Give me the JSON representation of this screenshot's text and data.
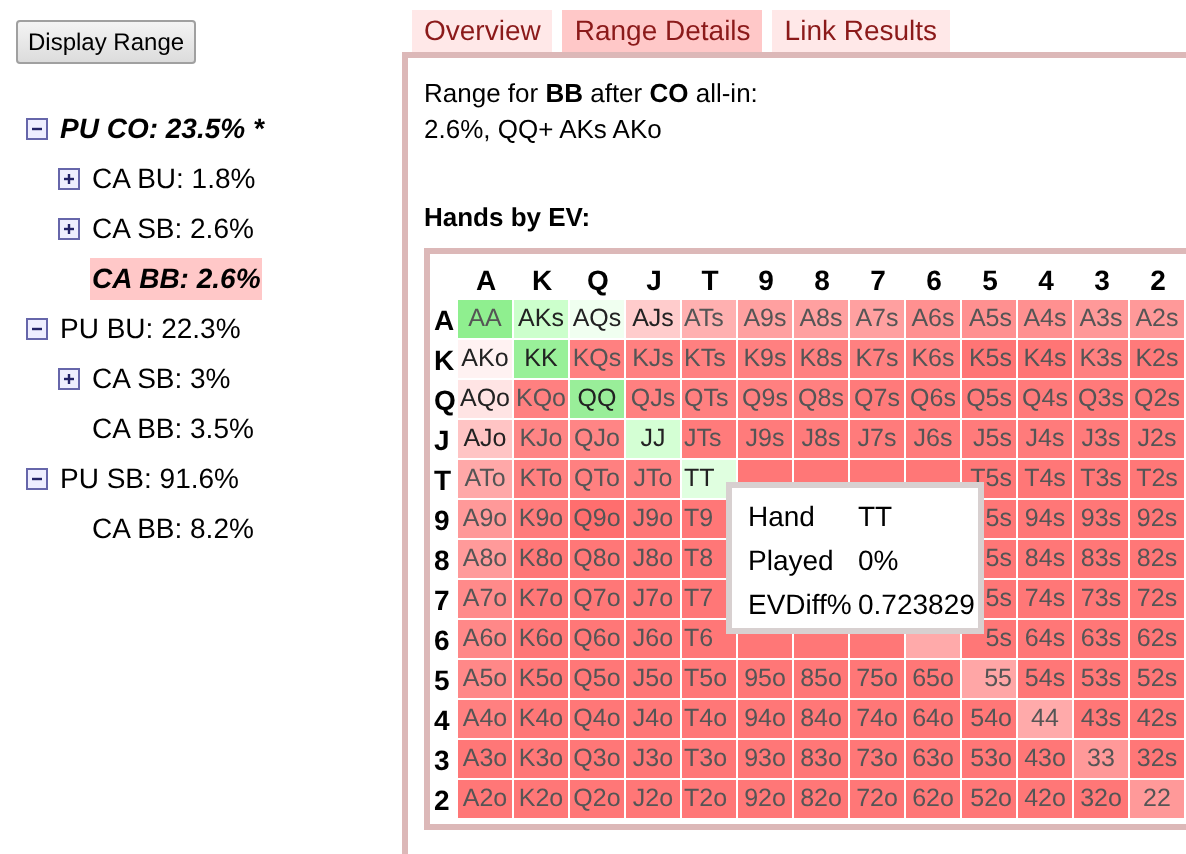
{
  "display_button": "Display Range",
  "tree": [
    {
      "label": "PU CO: 23.5% *",
      "expanded": true,
      "emphasized": true,
      "selected": false,
      "children": [
        {
          "label": "CA BU: 1.8%",
          "expanded": false,
          "emphasized": false,
          "selected": false
        },
        {
          "label": "CA SB: 2.6%",
          "expanded": false,
          "emphasized": false,
          "selected": false
        },
        {
          "label": "CA BB: 2.6%",
          "emphasized": true,
          "selected": true
        }
      ]
    },
    {
      "label": "PU BU: 22.3%",
      "expanded": true,
      "emphasized": false,
      "selected": false,
      "children": [
        {
          "label": "CA SB: 3%",
          "expanded": false,
          "emphasized": false,
          "selected": false
        },
        {
          "label": "CA BB: 3.5%",
          "emphasized": false,
          "selected": false
        }
      ]
    },
    {
      "label": "PU SB: 91.6%",
      "expanded": true,
      "emphasized": false,
      "selected": false,
      "children": [
        {
          "label": "CA BB: 8.2%",
          "emphasized": false,
          "selected": false
        }
      ]
    }
  ],
  "tabs": [
    {
      "label": "Overview",
      "selected": false
    },
    {
      "label": "Range Details",
      "selected": true
    },
    {
      "label": "Link Results",
      "selected": false
    }
  ],
  "description": [
    "Range for **BB** after **CO** all-in:",
    "2.6%, QQ+ AKs AKo"
  ],
  "heading": "Hands by EV:",
  "grid": {
    "columns": [
      "A",
      "K",
      "Q",
      "J",
      "T",
      "9",
      "8",
      "7",
      "6",
      "5",
      "4",
      "3",
      "2"
    ],
    "rows": [
      {
        "label": "A",
        "cells": [
          {
            "text": "AA",
            "color": "#8fef8f"
          },
          {
            "text": "AKs",
            "color": "#ccffcc"
          },
          {
            "text": "AQs",
            "color": "#f0fff0"
          },
          {
            "text": "AJs",
            "color": "#ffcccc"
          },
          {
            "text": "ATs",
            "color": "#ffb0b0"
          },
          {
            "text": "A9s",
            "color": "#ffa0a0"
          },
          {
            "text": "A8s",
            "color": "#ffa0a0"
          },
          {
            "text": "A7s",
            "color": "#ffa0a0"
          },
          {
            "text": "A6s",
            "color": "#ff9090"
          },
          {
            "text": "A5s",
            "color": "#ff9090"
          },
          {
            "text": "A4s",
            "color": "#ff9090"
          },
          {
            "text": "A3s",
            "color": "#ff9999"
          },
          {
            "text": "A2s",
            "color": "#ff9999"
          }
        ]
      },
      {
        "label": "K",
        "cells": [
          {
            "text": "AKo",
            "color": "#fff2f2"
          },
          {
            "text": "KK",
            "color": "#99f099"
          },
          {
            "text": "KQs",
            "color": "#ff8080"
          },
          {
            "text": "KJs",
            "color": "#ff8080"
          },
          {
            "text": "KTs",
            "color": "#ff8080"
          },
          {
            "text": "K9s",
            "color": "#ff8080"
          },
          {
            "text": "K8s",
            "color": "#ff8080"
          },
          {
            "text": "K7s",
            "color": "#ff8080"
          },
          {
            "text": "K6s",
            "color": "#ff8080"
          },
          {
            "text": "K5s",
            "color": "#ff7575"
          },
          {
            "text": "K4s",
            "color": "#ff7575"
          },
          {
            "text": "K3s",
            "color": "#ff8080"
          },
          {
            "text": "K2s",
            "color": "#ff7a7a"
          }
        ]
      },
      {
        "label": "Q",
        "cells": [
          {
            "text": "AQo",
            "color": "#ffe4e4"
          },
          {
            "text": "KQo",
            "color": "#ff8080"
          },
          {
            "text": "QQ",
            "color": "#99ee99"
          },
          {
            "text": "QJs",
            "color": "#ff8080"
          },
          {
            "text": "QTs",
            "color": "#ff8080"
          },
          {
            "text": "Q9s",
            "color": "#ff8080"
          },
          {
            "text": "Q8s",
            "color": "#ff8080"
          },
          {
            "text": "Q7s",
            "color": "#ff7a7a"
          },
          {
            "text": "Q6s",
            "color": "#ff7a7a"
          },
          {
            "text": "Q5s",
            "color": "#ff7a7a"
          },
          {
            "text": "Q4s",
            "color": "#ff7a7a"
          },
          {
            "text": "Q3s",
            "color": "#ff7a7a"
          },
          {
            "text": "Q2s",
            "color": "#ff7a7a"
          }
        ]
      },
      {
        "label": "J",
        "cells": [
          {
            "text": "AJo",
            "color": "#ffc4c4"
          },
          {
            "text": "KJo",
            "color": "#ff8585"
          },
          {
            "text": "QJo",
            "color": "#ff8585"
          },
          {
            "text": "JJ",
            "color": "#d4ffd4"
          },
          {
            "text": "JTs",
            "color": "#ff7b7b"
          },
          {
            "text": "J9s",
            "color": "#ff7b7b"
          },
          {
            "text": "J8s",
            "color": "#ff7b7b"
          },
          {
            "text": "J7s",
            "color": "#ff7b7b"
          },
          {
            "text": "J6s",
            "color": "#ff7b7b"
          },
          {
            "text": "J5s",
            "color": "#ff7b7b"
          },
          {
            "text": "J4s",
            "color": "#ff7b7b"
          },
          {
            "text": "J3s",
            "color": "#ff7b7b"
          },
          {
            "text": "J2s",
            "color": "#ff7b7b"
          }
        ]
      },
      {
        "label": "T",
        "cells": [
          {
            "text": "ATo",
            "color": "#ffa8a8"
          },
          {
            "text": "KTo",
            "color": "#ff8080"
          },
          {
            "text": "QTo",
            "color": "#ff8080"
          },
          {
            "text": "JTo",
            "color": "#ff8080"
          },
          {
            "text": "TT",
            "color": "#e0ffe0"
          },
          {
            "text": null,
            "color": "#ff7777"
          },
          {
            "text": null,
            "color": "#ff7777"
          },
          {
            "text": null,
            "color": "#ff7777"
          },
          {
            "text": null,
            "color": "#ff7777"
          },
          {
            "text": "T5s",
            "color": "#ff7777"
          },
          {
            "text": "T4s",
            "color": "#ff7777"
          },
          {
            "text": "T3s",
            "color": "#ff7777"
          },
          {
            "text": "T2s",
            "color": "#ff7777"
          }
        ]
      },
      {
        "label": "9",
        "cells": [
          {
            "text": "A9o",
            "color": "#ff9999"
          },
          {
            "text": "K9o",
            "color": "#ff7b7b"
          },
          {
            "text": "Q9o",
            "color": "#ff6e6e"
          },
          {
            "text": "J9o",
            "color": "#ff7777"
          },
          {
            "text": "T9",
            "color": "#ff7777"
          },
          null,
          null,
          null,
          null,
          {
            "text": "5s",
            "color": "#ff7777"
          },
          {
            "text": "94s",
            "color": "#ff7777"
          },
          {
            "text": "93s",
            "color": "#ff7777"
          },
          {
            "text": "92s",
            "color": "#ff7777"
          }
        ]
      },
      {
        "label": "8",
        "cells": [
          {
            "text": "A8o",
            "color": "#ff9a9a"
          },
          {
            "text": "K8o",
            "color": "#ff7777"
          },
          {
            "text": "Q8o",
            "color": "#ff7777"
          },
          {
            "text": "J8o",
            "color": "#ff7777"
          },
          {
            "text": "T8",
            "color": "#ff7777"
          },
          null,
          null,
          null,
          null,
          {
            "text": "5s",
            "color": "#ff7777"
          },
          {
            "text": "84s",
            "color": "#ff7777"
          },
          {
            "text": "83s",
            "color": "#ff7777"
          },
          {
            "text": "82s",
            "color": "#ff7777"
          }
        ]
      },
      {
        "label": "7",
        "cells": [
          {
            "text": "A7o",
            "color": "#ff8a8a"
          },
          {
            "text": "K7o",
            "color": "#ff7777"
          },
          {
            "text": "Q7o",
            "color": "#ff7777"
          },
          {
            "text": "J7o",
            "color": "#ff7777"
          },
          {
            "text": "T7",
            "color": "#ff7777"
          },
          null,
          null,
          null,
          null,
          {
            "text": "5s",
            "color": "#ff7777"
          },
          {
            "text": "74s",
            "color": "#ff7777"
          },
          {
            "text": "73s",
            "color": "#ff7777"
          },
          {
            "text": "72s",
            "color": "#ff7777"
          }
        ]
      },
      {
        "label": "6",
        "cells": [
          {
            "text": "A6o",
            "color": "#ff8888"
          },
          {
            "text": "K6o",
            "color": "#ff7777"
          },
          {
            "text": "Q6o",
            "color": "#ff7777"
          },
          {
            "text": "J6o",
            "color": "#ff7777"
          },
          {
            "text": "T6",
            "color": "#ff7777"
          },
          {
            "text": null,
            "color": "#ff7777"
          },
          {
            "text": null,
            "color": "#ff7777"
          },
          {
            "text": null,
            "color": "#ff7777"
          },
          {
            "text": null,
            "color": "#ffaaaa"
          },
          {
            "text": "5s",
            "color": "#ff7777"
          },
          {
            "text": "64s",
            "color": "#ff7777"
          },
          {
            "text": "63s",
            "color": "#ff7777"
          },
          {
            "text": "62s",
            "color": "#ff7777"
          }
        ]
      },
      {
        "label": "5",
        "cells": [
          {
            "text": "A5o",
            "color": "#ff8888"
          },
          {
            "text": "K5o",
            "color": "#ff7777"
          },
          {
            "text": "Q5o",
            "color": "#ff7777"
          },
          {
            "text": "J5o",
            "color": "#ff7777"
          },
          {
            "text": "T5o",
            "color": "#ff7777"
          },
          {
            "text": "95o",
            "color": "#ff7777"
          },
          {
            "text": "85o",
            "color": "#ff7777"
          },
          {
            "text": "75o",
            "color": "#ff7777"
          },
          {
            "text": "65o",
            "color": "#ff7777"
          },
          {
            "text": "55",
            "color": "#ffa6a6"
          },
          {
            "text": "54s",
            "color": "#ff7777"
          },
          {
            "text": "53s",
            "color": "#ff7777"
          },
          {
            "text": "52s",
            "color": "#ff7777"
          }
        ]
      },
      {
        "label": "4",
        "cells": [
          {
            "text": "A4o",
            "color": "#ff8080"
          },
          {
            "text": "K4o",
            "color": "#ff7777"
          },
          {
            "text": "Q4o",
            "color": "#ff7777"
          },
          {
            "text": "J4o",
            "color": "#ff7777"
          },
          {
            "text": "T4o",
            "color": "#ff7777"
          },
          {
            "text": "94o",
            "color": "#ff7777"
          },
          {
            "text": "84o",
            "color": "#ff7777"
          },
          {
            "text": "74o",
            "color": "#ff7777"
          },
          {
            "text": "64o",
            "color": "#ff7777"
          },
          {
            "text": "54o",
            "color": "#ff7777"
          },
          {
            "text": "44",
            "color": "#ffaaaa"
          },
          {
            "text": "43s",
            "color": "#ff7777"
          },
          {
            "text": "42s",
            "color": "#ff7777"
          }
        ]
      },
      {
        "label": "3",
        "cells": [
          {
            "text": "A3o",
            "color": "#ff7777"
          },
          {
            "text": "K3o",
            "color": "#ff7777"
          },
          {
            "text": "Q3o",
            "color": "#ff7777"
          },
          {
            "text": "J3o",
            "color": "#ff7777"
          },
          {
            "text": "T3o",
            "color": "#ff7777"
          },
          {
            "text": "93o",
            "color": "#ff7777"
          },
          {
            "text": "83o",
            "color": "#ff7777"
          },
          {
            "text": "73o",
            "color": "#ff7777"
          },
          {
            "text": "63o",
            "color": "#ff7777"
          },
          {
            "text": "53o",
            "color": "#ff7777"
          },
          {
            "text": "43o",
            "color": "#ff7777"
          },
          {
            "text": "33",
            "color": "#ff9999"
          },
          {
            "text": "32s",
            "color": "#ff7777"
          }
        ]
      },
      {
        "label": "2",
        "cells": [
          {
            "text": "A2o",
            "color": "#ff7777"
          },
          {
            "text": "K2o",
            "color": "#ff7777"
          },
          {
            "text": "Q2o",
            "color": "#ff7777"
          },
          {
            "text": "J2o",
            "color": "#ff7777"
          },
          {
            "text": "T2o",
            "color": "#ff7777"
          },
          {
            "text": "92o",
            "color": "#ff7777"
          },
          {
            "text": "82o",
            "color": "#ff7777"
          },
          {
            "text": "72o",
            "color": "#ff7777"
          },
          {
            "text": "62o",
            "color": "#ff7777"
          },
          {
            "text": "52o",
            "color": "#ff7777"
          },
          {
            "text": "42o",
            "color": "#ff7777"
          },
          {
            "text": "32o",
            "color": "#ff7777"
          },
          {
            "text": "22",
            "color": "#ff9999"
          }
        ]
      }
    ]
  },
  "tooltip": [
    {
      "label": "Hand",
      "value": "TT"
    },
    {
      "label": "Played",
      "value": "0%"
    },
    {
      "label": "EVDiff%",
      "value": "0.723829"
    }
  ]
}
